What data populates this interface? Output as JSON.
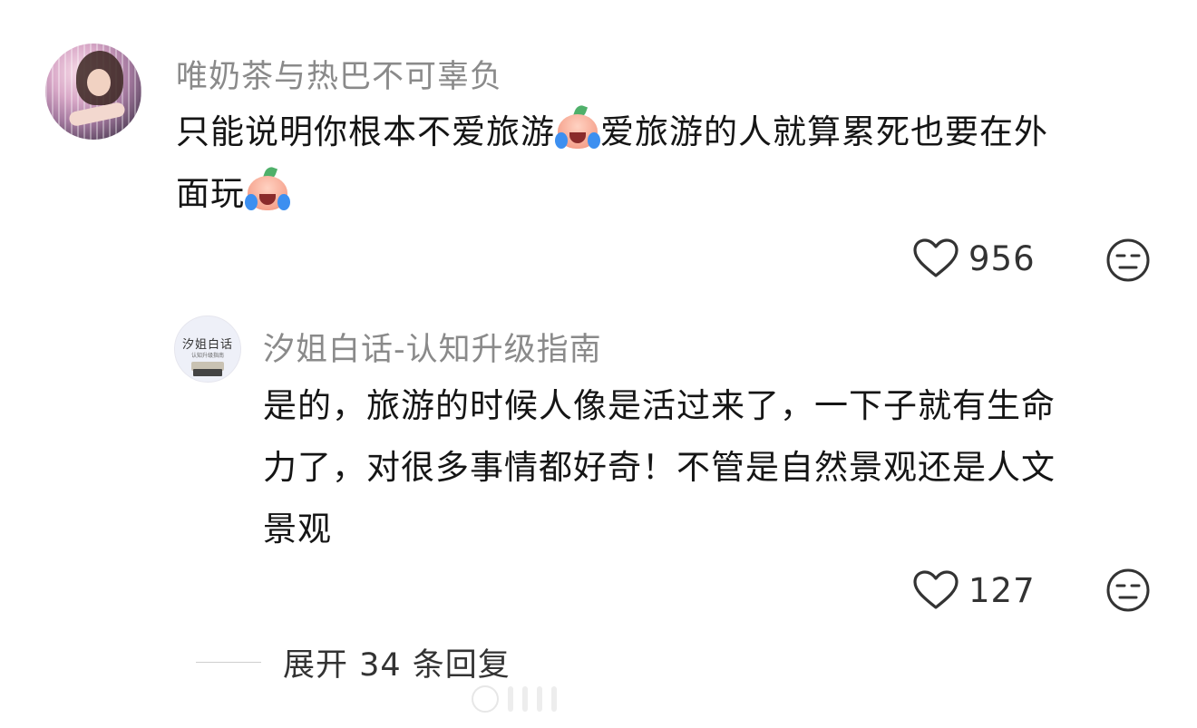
{
  "comment": {
    "username": "唯奶茶与热巴不可辜负",
    "text_line1_a": "只能说明你根本不爱旅游",
    "text_line1_b": "爱旅游的人就算累死也要在外",
    "text_line2": "面玩",
    "emoji": "crying-emoji",
    "likes": "956",
    "icons": {
      "like": "heart-outline-icon",
      "dislike": "meh-face-icon"
    }
  },
  "reply": {
    "avatar_logo": "汐姐白话",
    "avatar_logo_sub": "认知升级指南",
    "username": "汐姐白话-认知升级指南",
    "text_line1": "是的，旅游的时候人像是活过来了，一下子就有生命",
    "text_line2": "力了，对很多事情都好奇！不管是自然景观还是人文",
    "text_line3": "景观",
    "likes": "127",
    "icons": {
      "like": "heart-outline-icon",
      "dislike": "meh-face-icon"
    }
  },
  "expand": {
    "label": "展开 34 条回复"
  },
  "colors": {
    "username": "#8a8a8a",
    "text": "#151515",
    "icon": "#333333",
    "divider": "#cfcfcf"
  }
}
